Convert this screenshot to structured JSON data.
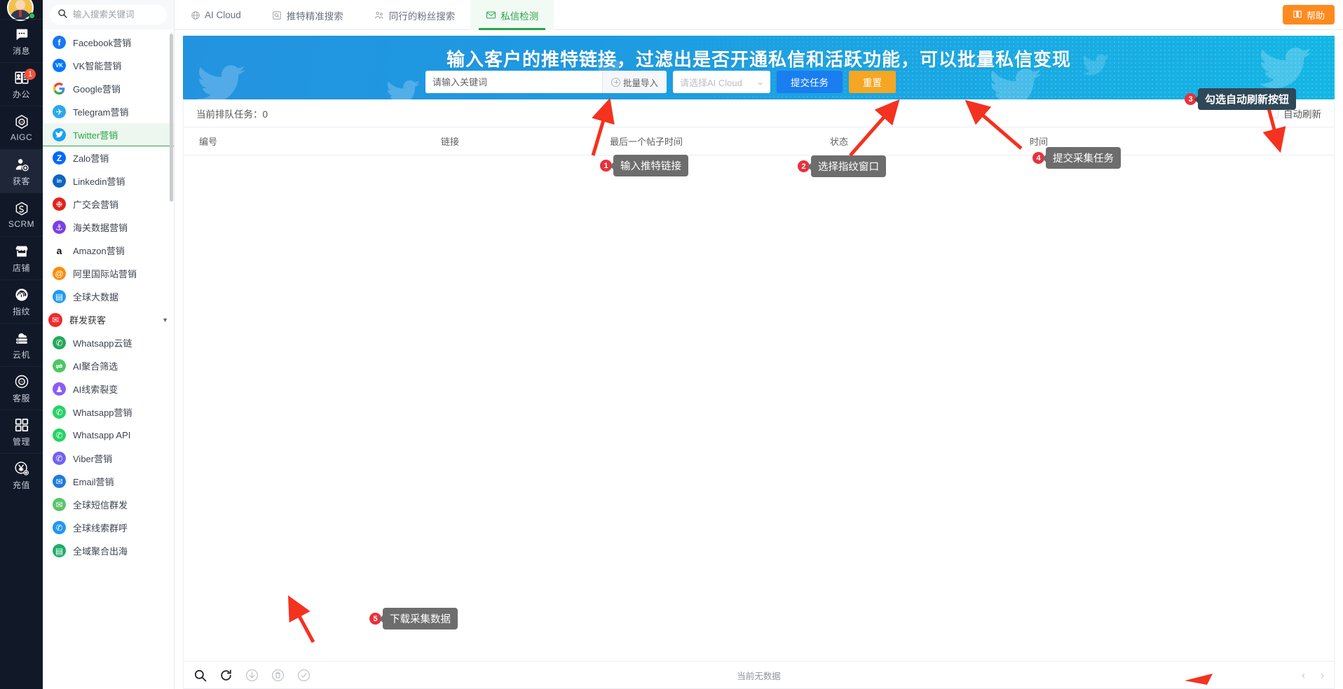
{
  "rail": {
    "avatar_name": "user-avatar",
    "items": [
      {
        "icon": "message-icon",
        "label": "消息",
        "badge": "",
        "active": false
      },
      {
        "icon": "office-contact-icon",
        "label": "办公",
        "badge": "1",
        "active": false
      },
      {
        "icon": "aigc-icon",
        "label": "AIGC",
        "badge": "",
        "active": false
      },
      {
        "icon": "acquire-customer-icon",
        "label": "获客",
        "badge": "",
        "active": true
      },
      {
        "icon": "scrm-icon",
        "label": "SCRM",
        "badge": "",
        "active": false
      },
      {
        "icon": "shop-icon",
        "label": "店铺",
        "badge": "",
        "active": false
      },
      {
        "icon": "fingerprint-icon",
        "label": "指纹",
        "badge": "",
        "active": false
      },
      {
        "icon": "cloud-machine-icon",
        "label": "云机",
        "badge": "",
        "active": false
      },
      {
        "icon": "customer-service-icon",
        "label": "客服",
        "badge": "",
        "active": false
      },
      {
        "icon": "grid-manage-icon",
        "label": "管理",
        "badge": "",
        "active": false
      },
      {
        "icon": "recharge-icon",
        "label": "充值",
        "badge": "",
        "active": false
      }
    ]
  },
  "sidebar": {
    "search_placeholder": "输入搜索关键词",
    "search_value": "",
    "items": [
      {
        "label": "Facebook营销",
        "icon": "facebook-icon",
        "color": "#1877F2",
        "glyph": "f",
        "active": false,
        "type": "item"
      },
      {
        "label": "VK智能营销",
        "icon": "vk-icon",
        "color": "#0077FF",
        "glyph": "VK",
        "active": false,
        "type": "item"
      },
      {
        "label": "Google营销",
        "icon": "google-icon",
        "color": "#ffffff",
        "glyph": "G",
        "active": false,
        "type": "item"
      },
      {
        "label": "Telegram营销",
        "icon": "telegram-icon",
        "color": "#29A9EB",
        "glyph": "✈",
        "active": false,
        "type": "item"
      },
      {
        "label": "Twitter营销",
        "icon": "twitter-icon",
        "color": "#1DA1F2",
        "glyph": "🐦",
        "active": true,
        "type": "item"
      },
      {
        "label": "Zalo营销",
        "icon": "zalo-icon",
        "color": "#0068FF",
        "glyph": "Z",
        "active": false,
        "type": "item"
      },
      {
        "label": "Linkedin营销",
        "icon": "linkedin-icon",
        "color": "#0A66C2",
        "glyph": "in",
        "active": false,
        "type": "item"
      },
      {
        "label": "广交会营销",
        "icon": "canton-fair-icon",
        "color": "#E2231A",
        "glyph": "❉",
        "active": false,
        "type": "item"
      },
      {
        "label": "海关数据营销",
        "icon": "customs-data-icon",
        "color": "#7B3FE4",
        "glyph": "⚓",
        "active": false,
        "type": "item"
      },
      {
        "label": "Amazon营销",
        "icon": "amazon-icon",
        "color": "#ffffff",
        "glyph": "a",
        "active": false,
        "type": "item"
      },
      {
        "label": "阿里国际站营销",
        "icon": "alibaba-icon",
        "color": "#FF8A00",
        "glyph": "@",
        "active": false,
        "type": "item"
      },
      {
        "label": "全球大数据",
        "icon": "global-bigdata-icon",
        "color": "#1E9BF0",
        "glyph": "▤",
        "active": false,
        "type": "item"
      },
      {
        "label": "群发获客",
        "icon": "mass-send-icon",
        "color": "#F02B2B",
        "glyph": "✉",
        "active": false,
        "type": "group"
      },
      {
        "label": "Whatsapp云链",
        "icon": "whatsapp-cloud-icon",
        "color": "#25A85B",
        "glyph": "✆",
        "active": false,
        "type": "item"
      },
      {
        "label": "AI聚合筛选",
        "icon": "ai-filter-icon",
        "color": "#4CC764",
        "glyph": "⇌",
        "active": false,
        "type": "item"
      },
      {
        "label": "AI线索裂变",
        "icon": "ai-lead-icon",
        "color": "#8B5CF6",
        "glyph": "♟",
        "active": false,
        "type": "item"
      },
      {
        "label": "Whatsapp营销",
        "icon": "whatsapp-icon",
        "color": "#25D366",
        "glyph": "✆",
        "active": false,
        "type": "item"
      },
      {
        "label": "Whatsapp API",
        "icon": "whatsapp-api-icon",
        "color": "#25D366",
        "glyph": "✆",
        "active": false,
        "type": "item"
      },
      {
        "label": "Viber营销",
        "icon": "viber-icon",
        "color": "#7360F2",
        "glyph": "✆",
        "active": false,
        "type": "item"
      },
      {
        "label": "Email营销",
        "icon": "email-icon",
        "color": "#1E7AE0",
        "glyph": "✉",
        "active": false,
        "type": "item"
      },
      {
        "label": "全球短信群发",
        "icon": "global-sms-icon",
        "color": "#5CC46A",
        "glyph": "✉",
        "active": false,
        "type": "item"
      },
      {
        "label": "全球线索群呼",
        "icon": "global-call-icon",
        "color": "#2196F3",
        "glyph": "✆",
        "active": false,
        "type": "item"
      },
      {
        "label": "全域聚合出海",
        "icon": "global-aggregate-icon",
        "color": "#1FAD66",
        "glyph": "▤",
        "active": false,
        "type": "item"
      }
    ]
  },
  "topbar": {
    "tabs": [
      {
        "label": "AI Cloud",
        "icon": "cloud-icon",
        "active": false
      },
      {
        "label": "推特精准搜索",
        "icon": "search-doc-icon",
        "active": false
      },
      {
        "label": "同行的粉丝搜索",
        "icon": "followers-icon",
        "active": false
      },
      {
        "label": "私信检测",
        "icon": "dm-check-icon",
        "active": true
      }
    ],
    "help_label": "帮助",
    "help_icon": "book-icon",
    "help_color": "#ff8a1f"
  },
  "banner": {
    "title": "输入客户的推特链接，过滤出是否开通私信和活跃功能，可以批量私信变现",
    "keyword_placeholder": "请输入关键词",
    "keyword_value": "",
    "batch_import_label": "批量导入",
    "select_placeholder": "请选择AI Cloud",
    "select_value": "",
    "submit_label": "提交任务",
    "reset_label": "重置",
    "submit_color": "#1a7df0",
    "reset_color": "#f5a623"
  },
  "queue": {
    "label": "当前排队任务：0",
    "auto_refresh_label": "自动刷新",
    "auto_refresh_checked": false
  },
  "table": {
    "columns": [
      "编号",
      "链接",
      "最后一个帖子时间",
      "状态",
      "时间"
    ],
    "rows": [],
    "empty_text": "当前无数据",
    "footer_icons": [
      "search-icon",
      "refresh-icon",
      "download-icon",
      "delete-icon",
      "check-circle-icon"
    ],
    "prev_label": "‹",
    "next_label": "›"
  },
  "annotations": [
    {
      "num": "1",
      "text": "输入推特链接",
      "style": "gray"
    },
    {
      "num": "2",
      "text": "选择指纹窗口",
      "style": "gray"
    },
    {
      "num": "3",
      "text": "勾选自动刷新按钮",
      "style": "dark"
    },
    {
      "num": "4",
      "text": "提交采集任务",
      "style": "gray"
    },
    {
      "num": "5",
      "text": "下载采集数据",
      "style": "gray"
    }
  ]
}
